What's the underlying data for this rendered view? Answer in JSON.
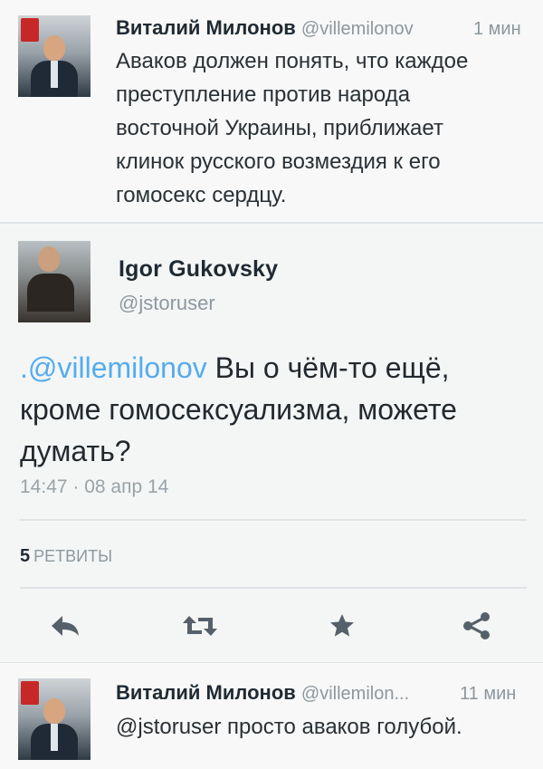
{
  "tweet1": {
    "name": "Виталий Милонов",
    "handle": "@villemilonov",
    "time": "1 мин",
    "lines": [
      "Аваков должен понять, что каждое",
      "преступление против народа",
      "восточной Украины, приближает",
      "клинок русского возмездия к его",
      "гомосекс сердцу."
    ]
  },
  "main_tweet": {
    "name": "Igor Gukovsky",
    "handle": "@jstoruser",
    "mention": ".@villemilonov",
    "text_after_mention": " Вы о чём-то ещё, кроме гомосексуализма, можете думать?",
    "timestamp": "14:47 · 08 апр 14",
    "retweet_count": "5",
    "retweet_label": "РЕТВИТЫ",
    "actions": [
      "reply-icon",
      "retweet-icon",
      "favorite-icon",
      "share-icon"
    ],
    "mention_color": "#55acee"
  },
  "tweet3": {
    "name": "Виталий Милонов",
    "handle": "@villemilon...",
    "time": "11 мин",
    "text": "@jstoruser просто аваков голубой."
  }
}
